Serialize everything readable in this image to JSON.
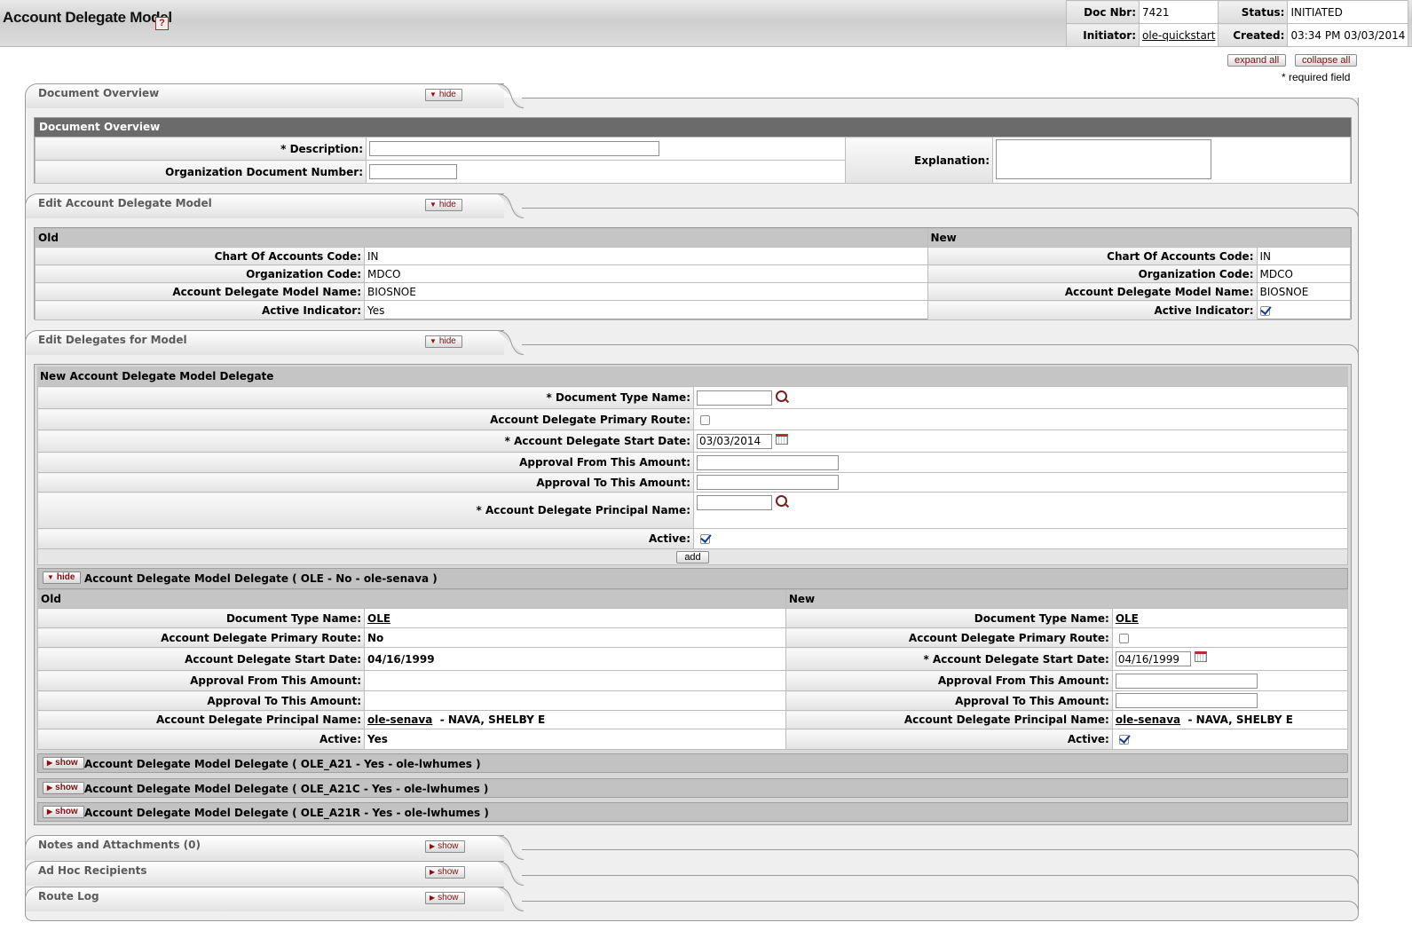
{
  "header": {
    "title": "Account Delegate Model",
    "help_icon": "?",
    "doc_nbr_label": "Doc Nbr:",
    "doc_nbr": "7421",
    "status_label": "Status:",
    "status": "INITIATED",
    "initiator_label": "Initiator:",
    "initiator": "ole-quickstart",
    "created_label": "Created:",
    "created": "03:34 PM 03/03/2014"
  },
  "toolbar": {
    "expand_all": "expand all",
    "collapse_all": "collapse all",
    "required_note": "* required field"
  },
  "buttons": {
    "hide": "hide",
    "show": "show",
    "add": "add"
  },
  "doc_overview": {
    "tab_title": "Document Overview",
    "subheader": "Document Overview",
    "description_label": "* Description:",
    "org_doc_number_label": "Organization Document Number:",
    "explanation_label": "Explanation:",
    "description_value": "",
    "org_doc_number_value": "",
    "explanation_value": ""
  },
  "edit_model": {
    "tab_title": "Edit Account Delegate Model",
    "old_label": "Old",
    "new_label": "New",
    "rows": [
      {
        "label": "Chart Of Accounts Code:",
        "old": "IN",
        "new": "IN"
      },
      {
        "label": "Organization Code:",
        "old": "MDCO",
        "new": "MDCO"
      },
      {
        "label": "Account Delegate Model Name:",
        "old": "BIOSNOE",
        "new": "BIOSNOE"
      },
      {
        "label": "Active Indicator:",
        "old": "Yes",
        "new": "checked"
      }
    ]
  },
  "edit_delegates": {
    "tab_title": "Edit Delegates for Model",
    "new_subheader": "New Account Delegate Model Delegate",
    "new_fields": {
      "doc_type_label": "* Document Type Name:",
      "primary_route_label": "Account Delegate Primary Route:",
      "start_date_label": "* Account Delegate Start Date:",
      "start_date_value": "03/03/2014",
      "from_amount_label": "Approval From This Amount:",
      "to_amount_label": "Approval To This Amount:",
      "principal_label": "* Account Delegate Principal Name:",
      "active_label": "Active:"
    },
    "delegate_1": {
      "title": "Account Delegate Model Delegate ( OLE - No - ole-senava )",
      "old_label": "Old",
      "new_label": "New",
      "doc_type_label": "Document Type Name:",
      "doc_type_old": "OLE",
      "doc_type_new": "OLE",
      "primary_route_label": "Account Delegate Primary Route:",
      "primary_route_old": "No",
      "start_date_label": "Account Delegate Start Date:",
      "start_date_label_req": "* Account Delegate Start Date:",
      "start_date_old": "04/16/1999",
      "start_date_new": "04/16/1999",
      "from_amount_label": "Approval From This Amount:",
      "to_amount_label": "Approval To This Amount:",
      "principal_label": "Account Delegate Principal Name:",
      "principal_id": "ole-senava",
      "principal_name": "- NAVA, SHELBY E",
      "active_label": "Active:",
      "active_old": "Yes"
    },
    "collapsed": [
      "Account Delegate Model Delegate ( OLE_A21 - Yes - ole-lwhumes )",
      "Account Delegate Model Delegate ( OLE_A21C - Yes - ole-lwhumes )",
      "Account Delegate Model Delegate ( OLE_A21R - Yes - ole-lwhumes )"
    ]
  },
  "bottom_tabs": {
    "notes": "Notes and Attachments (0)",
    "adhoc": "Ad Hoc Recipients",
    "route_log": "Route Log"
  }
}
